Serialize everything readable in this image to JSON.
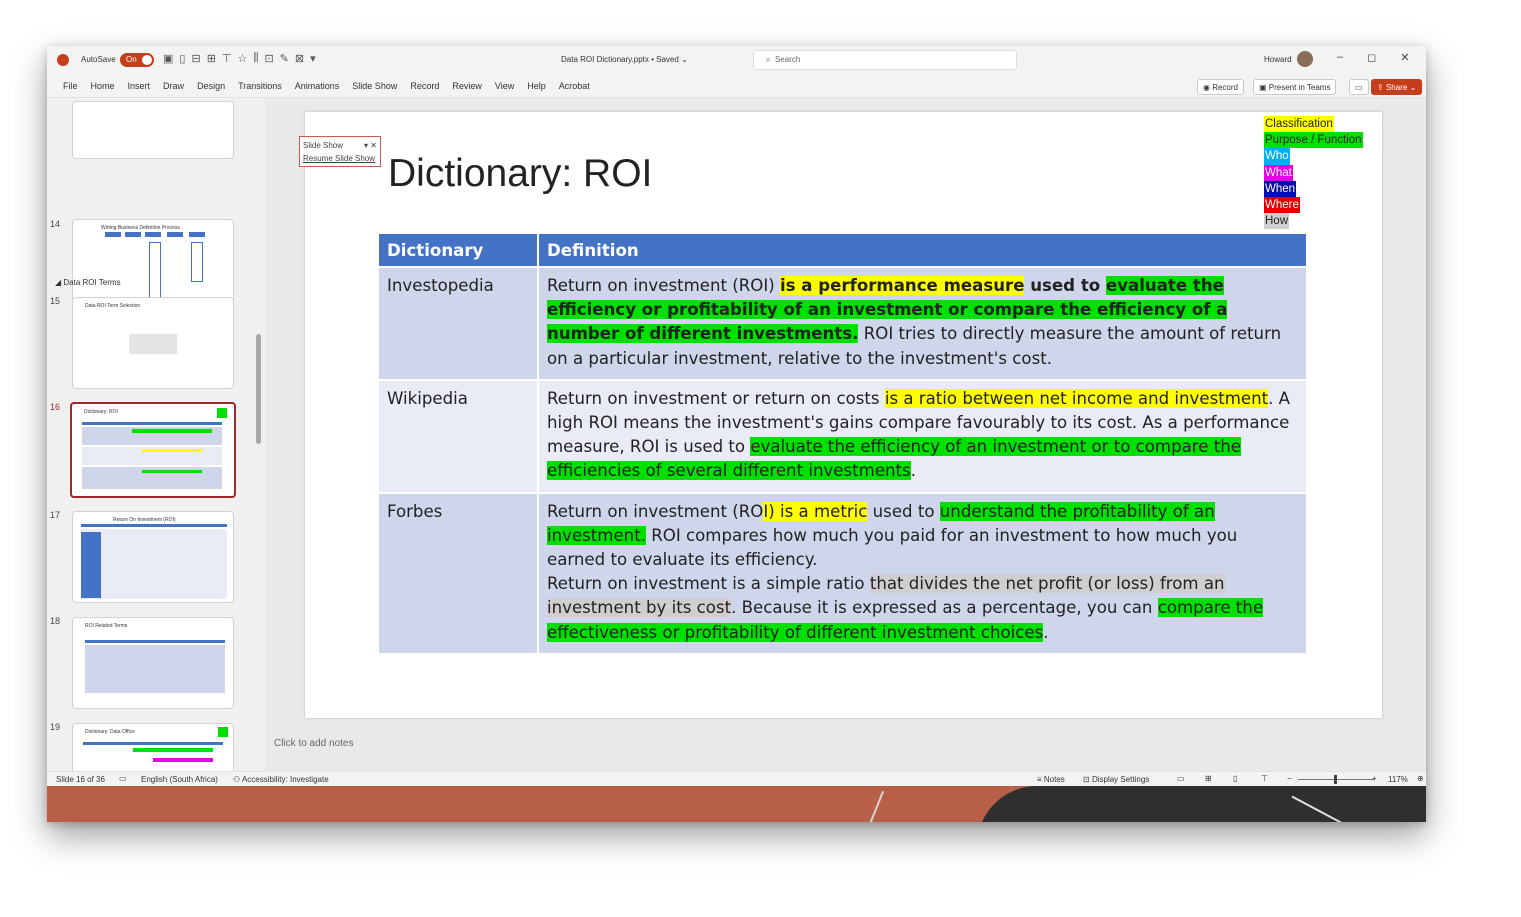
{
  "titlebar": {
    "autosave_label": "AutoSave",
    "autosave_state": "On",
    "doc_title": "Data ROI Dictionary.pptx",
    "doc_status": "• Saved",
    "search_placeholder": "Search",
    "user_name": "Howard",
    "minimize": "–",
    "restore": "◻",
    "close": "✕"
  },
  "ribbon": {
    "tabs": [
      "File",
      "Home",
      "Insert",
      "Draw",
      "Design",
      "Transitions",
      "Animations",
      "Slide Show",
      "Record",
      "Review",
      "View",
      "Help",
      "Acrobat"
    ],
    "record_label": "Record",
    "present_label": "Present in Teams",
    "share_label": "Share"
  },
  "thumbnails": {
    "section_label": "Data ROI Terms",
    "slides": [
      {
        "num": "14",
        "title": "Writing Business Definition Process"
      },
      {
        "num": "15",
        "title": "Data ROI Term Selection"
      },
      {
        "num": "16",
        "title": "Dictionary: ROI"
      },
      {
        "num": "17",
        "title": "Return On Investment (ROI)"
      },
      {
        "num": "18",
        "title": "ROI Related Terms"
      },
      {
        "num": "19",
        "title": "Dictionary: Data Office"
      }
    ]
  },
  "popup": {
    "title": "Slide Show",
    "resume": "Resume Slide Show"
  },
  "slide": {
    "title": "Dictionary: ROI",
    "legend": [
      {
        "label": "Classification",
        "color": "#ffff00",
        "text_color": "#222222"
      },
      {
        "label": "Purpose / Function",
        "color": "#00e000",
        "text_color": "#222222"
      },
      {
        "label": "Who",
        "color": "#00b0f0",
        "text_color": "#ffffff"
      },
      {
        "label": "What",
        "color": "#e600e6",
        "text_color": "#ffffff"
      },
      {
        "label": "When",
        "color": "#0a0aa8",
        "text_color": "#ffffff"
      },
      {
        "label": "Where",
        "color": "#e00000",
        "text_color": "#ffffff"
      },
      {
        "label": "How",
        "color": "#d0cece",
        "text_color": "#222222"
      }
    ],
    "table": {
      "headers": [
        "Dictionary",
        "Definition"
      ],
      "rows": [
        {
          "source": "Investopedia",
          "segments": [
            {
              "t": "Return on investment (ROI) ",
              "h": ""
            },
            {
              "t": "is a performance measure",
              "h": "y",
              "b": true
            },
            {
              "t": " used to ",
              "h": "",
              "b": true
            },
            {
              "t": "evaluate the efficiency or profitability of an investment or compare the efficiency of a number of different investments.",
              "h": "g",
              "b": true
            },
            {
              "t": " ROI tries to directly measure the amount of return on a particular investment, relative to the investment's cost.",
              "h": ""
            }
          ]
        },
        {
          "source": "Wikipedia",
          "segments": [
            {
              "t": "Return on investment or return on costs ",
              "h": ""
            },
            {
              "t": "is a ratio between net income and investment",
              "h": "y"
            },
            {
              "t": ". A high ROI means the investment's gains compare favourably to its cost. As a performance measure, ROI is used to ",
              "h": ""
            },
            {
              "t": "evaluate the efficiency of an investment or to compare the efficiencies of several different investments",
              "h": "g"
            },
            {
              "t": ".",
              "h": ""
            }
          ]
        },
        {
          "source": "Forbes",
          "segments": [
            {
              "t": "Return on investment (RO",
              "h": ""
            },
            {
              "t": "I) is a metric",
              "h": "y"
            },
            {
              "t": " used to ",
              "h": ""
            },
            {
              "t": "understand the profitability of an investment.",
              "h": "g"
            },
            {
              "t": " ROI compares how much you paid for an investment to how much you earned to evaluate its efficiency.",
              "h": ""
            },
            {
              "t": "\n",
              "h": ""
            },
            {
              "t": "Return on investment is a simple ratio ",
              "h": ""
            },
            {
              "t": "that divides the net profit (or loss) from an investment by its cost",
              "h": "gr"
            },
            {
              "t": ". Because it is expressed as a percentage, you can ",
              "h": ""
            },
            {
              "t": "compare the effectiveness or profitability of different investment choices",
              "h": "g"
            },
            {
              "t": ".",
              "h": ""
            }
          ]
        }
      ]
    }
  },
  "notes_hint": "Click to add notes",
  "status": {
    "slide_info": "Slide 16 of 36",
    "language": "English (South Africa)",
    "accessibility": "Accessibility: Investigate",
    "notes": "Notes",
    "display_settings": "Display Settings",
    "zoom": "117%"
  }
}
